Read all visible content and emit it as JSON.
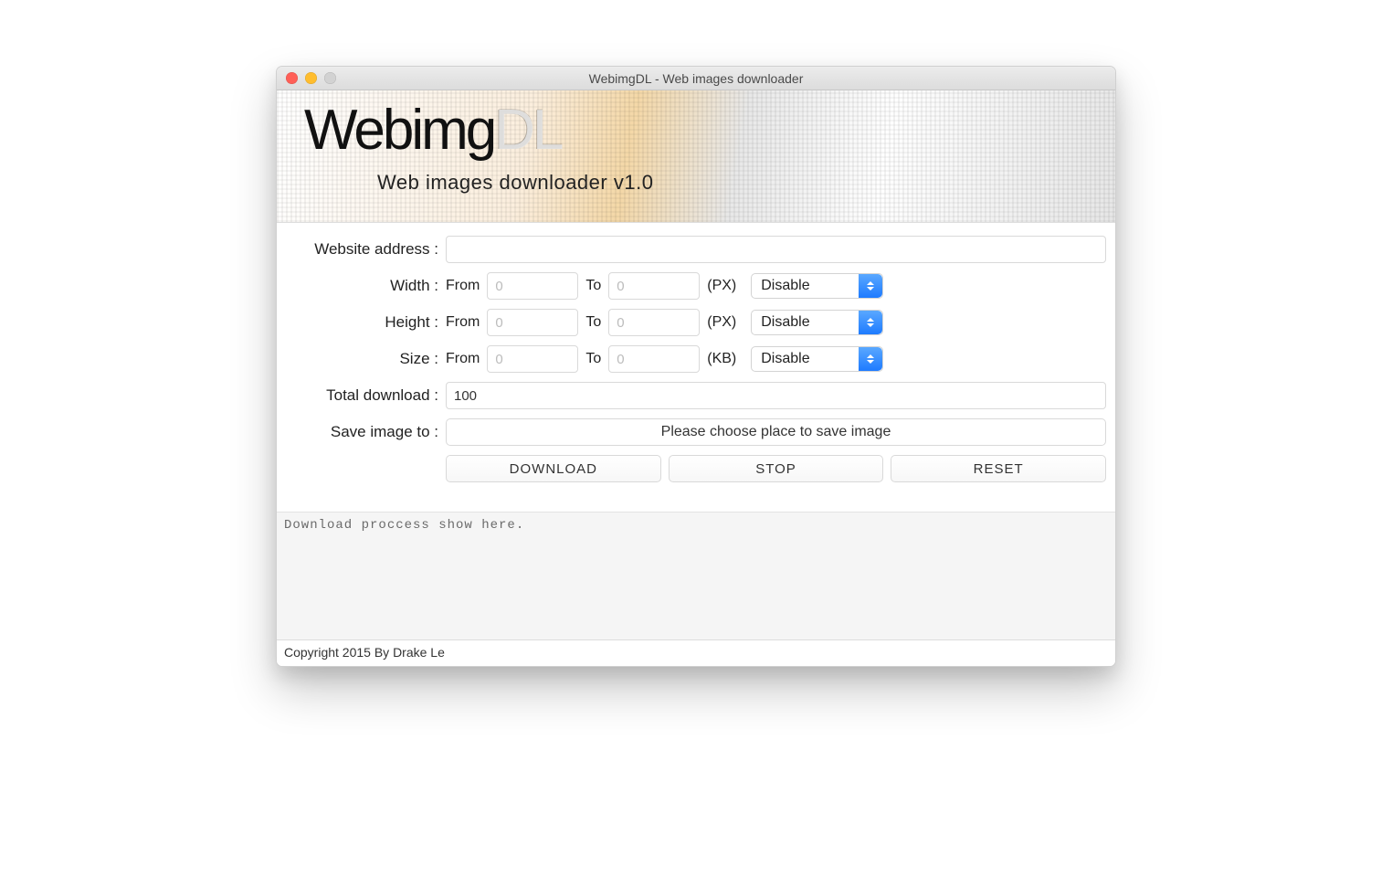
{
  "window": {
    "title": "WebimgDL - Web images downloader"
  },
  "banner": {
    "logo_main": "Webimg",
    "logo_suffix": "DL",
    "subtitle": "Web images downloader v1.0"
  },
  "form": {
    "website_label": "Website address :",
    "website_value": "",
    "width": {
      "label": "Width :",
      "from_label": "From",
      "from_placeholder": "0",
      "to_label": "To",
      "to_placeholder": "0",
      "unit": "(PX)",
      "select": "Disable"
    },
    "height": {
      "label": "Height :",
      "from_label": "From",
      "from_placeholder": "0",
      "to_label": "To",
      "to_placeholder": "0",
      "unit": "(PX)",
      "select": "Disable"
    },
    "size": {
      "label": "Size :",
      "from_label": "From",
      "from_placeholder": "0",
      "to_label": "To",
      "to_placeholder": "0",
      "unit": "(KB)",
      "select": "Disable"
    },
    "total": {
      "label": "Total download :",
      "value": "100"
    },
    "save": {
      "label": "Save image to :",
      "button": "Please choose place to save image"
    },
    "buttons": {
      "download": "DOWNLOAD",
      "stop": "STOP",
      "reset": "RESET"
    }
  },
  "console": {
    "text": "Download proccess show here."
  },
  "footer": {
    "copyright": "Copyright 2015 By Drake Le"
  }
}
